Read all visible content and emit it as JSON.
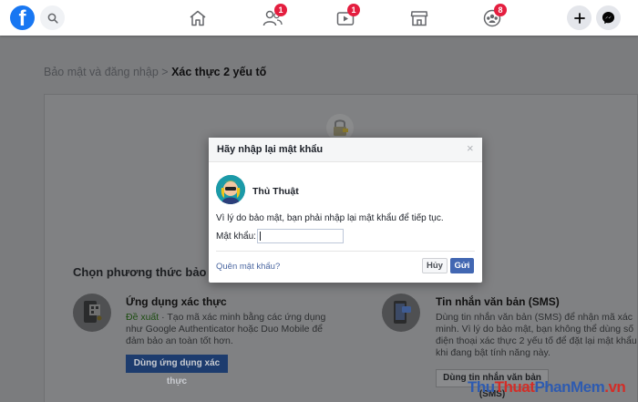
{
  "topbar": {
    "logo_letter": "f",
    "nav_badges": {
      "friends": "1",
      "watch": "1",
      "groups": "8"
    }
  },
  "page": {
    "breadcrumb_parent": "Bảo mật và đăng nhập",
    "breadcrumb_separator": ">",
    "breadcrumb_current": "Xác thực 2 yếu tố",
    "method_heading": "Chọn phương thức bảo mật",
    "auth_app": {
      "title": "Ứng dụng xác thực",
      "recommended": "Đề xuất",
      "description": " · Tạo mã xác minh bằng các ứng dụng như Google Authenticator hoặc Duo Mobile để đảm bảo an toàn tốt hơn.",
      "button": "Dùng ứng dụng xác thực"
    },
    "sms": {
      "title": "Tin nhắn văn bản (SMS)",
      "description": "Dùng tin nhắn văn bản (SMS) để nhận mã xác minh. Vì lý do bảo mật, bạn không thể dùng số điện thoại xác thực 2 yếu tố để đặt lại mật khẩu khi đang bật tính năng này.",
      "button": "Dùng tin nhắn văn bản (SMS)"
    }
  },
  "modal": {
    "title": "Hãy nhập lại mật khẩu",
    "close_glyph": "×",
    "user_name": "Thủ Thuật",
    "message": "Vì lý do bảo mật, bạn phải nhập lại mật khẩu để tiếp tục.",
    "password_label": "Mật khẩu:",
    "password_value": "",
    "forgot_link": "Quên mật khẩu?",
    "cancel_button": "Hủy",
    "send_button": "Gửi"
  },
  "watermark": {
    "part1": "Thu",
    "part2": "Thuat",
    "part3": "PhanMem",
    "part4": ".vn"
  },
  "colors": {
    "facebook_blue": "#1877f2",
    "badge_red": "#e41e3f",
    "button_blue": "#4267b2",
    "link_blue": "#4b67a1"
  },
  "icons": [
    "facebook-logo",
    "search-icon",
    "home-icon",
    "friends-icon",
    "watch-icon",
    "marketplace-icon",
    "groups-icon",
    "plus-icon",
    "messenger-icon",
    "lock-icon",
    "qr-phone-icon",
    "sms-phone-icon",
    "close-icon"
  ]
}
